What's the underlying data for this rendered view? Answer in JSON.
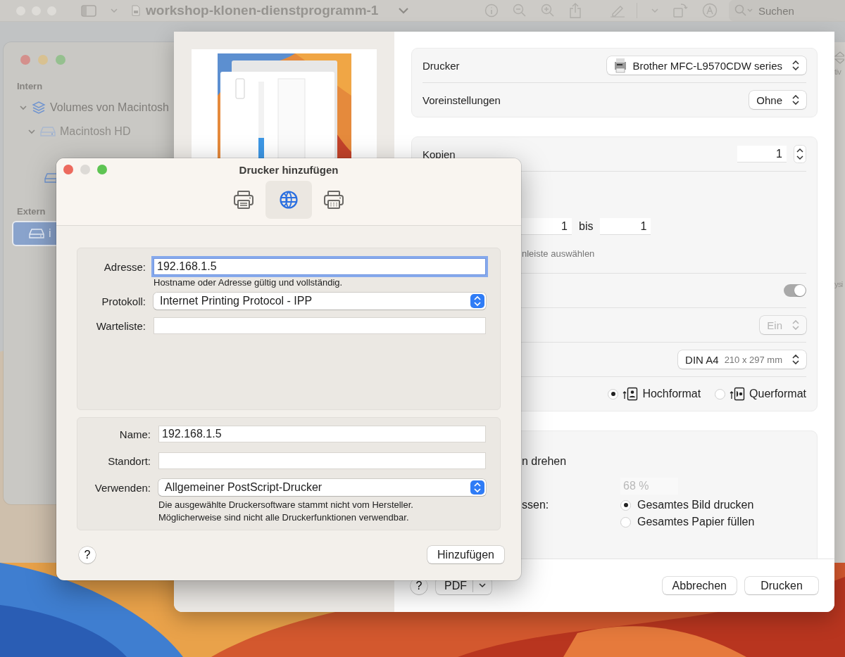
{
  "back_window": {
    "title": "workshop-klonen-dienstprogramm-1",
    "search_placeholder": "Suchen",
    "edge_texts": [
      "tiv",
      "ysi"
    ]
  },
  "disk_utility": {
    "sections": [
      {
        "title": "Intern",
        "items": [
          {
            "label": "Volumes von Macintosh",
            "kind": "stack",
            "expanded": true,
            "selected": false,
            "disabled": false,
            "children": [
              {
                "label": "Macintosh HD",
                "kind": "disk",
                "expanded": true,
                "selected": false,
                "disabled": true,
                "children": [
                  {
                    "kind": "disk",
                    "selected": false,
                    "disabled": false
                  }
                ]
              }
            ]
          }
        ]
      },
      {
        "title": "Extern",
        "items": [
          {
            "label": "i",
            "kind": "disk",
            "selected": true,
            "disabled": false
          }
        ]
      }
    ]
  },
  "print_dialog": {
    "preview": {
      "kind": "picture"
    },
    "printer": {
      "label": "Drucker",
      "value": "Brother MFC-L9570CDW series"
    },
    "presets": {
      "label": "Voreinstellungen",
      "value": "Ohne"
    },
    "copies": {
      "label": "Kopien",
      "value": "1"
    },
    "pages": {
      "from": "1",
      "to_label": "bis",
      "to": "1",
      "hint": "nleiste auswählen"
    },
    "toggle": {
      "on": true,
      "disabled": true
    },
    "option_popup": {
      "value": "Ein",
      "disabled": true
    },
    "paper_size": {
      "value": "DIN A4",
      "detail": "210 x 297 mm"
    },
    "orientation": [
      {
        "label": "Hochformat",
        "kind": "portrait",
        "selected": true
      },
      {
        "label": "Querformat",
        "kind": "landscape",
        "selected": false
      }
    ],
    "rotate_label": "n drehen",
    "scale": {
      "value": "68 %",
      "disabled": true
    },
    "fit_label": "ssen:",
    "fit_options": [
      {
        "label": "Gesamtes Bild drucken",
        "selected": true
      },
      {
        "label": "Gesamtes Papier füllen",
        "selected": false
      }
    ],
    "help": "?",
    "pdf": "PDF",
    "buttons": [
      "Abbrechen",
      "Drucken"
    ]
  },
  "add_printer": {
    "title": "Drucker hinzufügen",
    "tabs": [
      {
        "kind": "local",
        "selected": false
      },
      {
        "kind": "ip",
        "selected": true
      },
      {
        "kind": "windows",
        "selected": false
      }
    ],
    "address": {
      "label": "Adresse:",
      "value": "192.168.1.5",
      "focused": true,
      "hint": "Hostname oder Adresse gültig und vollständig."
    },
    "protocol": {
      "label": "Protokoll:",
      "value": "Internet Printing Protocol - IPP"
    },
    "queue": {
      "label": "Warteliste:"
    },
    "name": {
      "label": "Name:",
      "value": "192.168.1.5"
    },
    "location": {
      "label": "Standort:"
    },
    "use": {
      "label": "Verwenden:",
      "value": "Allgemeiner PostScript-Drucker"
    },
    "notes": [
      "Die ausgewählte Druckersoftware stammt nicht vom Hersteller.",
      "Möglicherweise sind nicht alle Druckerfunktionen verwendbar."
    ],
    "help": "?",
    "add_button": "Hinzufügen"
  }
}
